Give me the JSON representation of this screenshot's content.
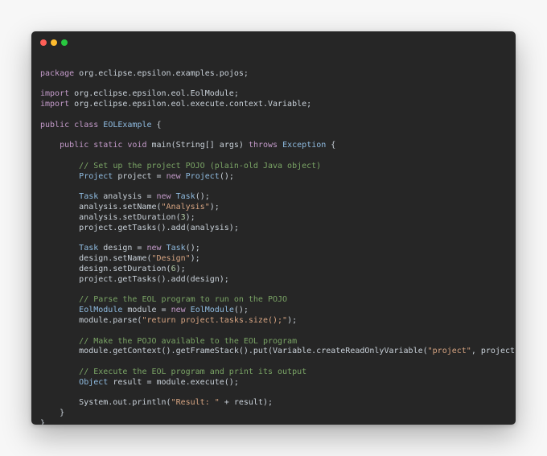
{
  "window": {
    "buttons": {
      "close_color": "#ff5f57",
      "minimize_color": "#febc2e",
      "maximize_color": "#28c840"
    }
  },
  "editor": {
    "language": "java",
    "lines": [
      [],
      [
        [
          "kw",
          "package"
        ],
        [
          "t",
          " org.eclipse.epsilon.examples.pojos;"
        ]
      ],
      [],
      [
        [
          "kw",
          "import"
        ],
        [
          "t",
          " org.eclipse.epsilon.eol.EolModule;"
        ]
      ],
      [
        [
          "kw",
          "import"
        ],
        [
          "t",
          " org.eclipse.epsilon.eol.execute.context.Variable;"
        ]
      ],
      [],
      [
        [
          "kw",
          "public"
        ],
        [
          "t",
          " "
        ],
        [
          "kw",
          "class"
        ],
        [
          "t",
          " "
        ],
        [
          "ty",
          "EOLExample"
        ],
        [
          "t",
          " {"
        ]
      ],
      [],
      [
        [
          "t",
          "    "
        ],
        [
          "kw",
          "public"
        ],
        [
          "t",
          " "
        ],
        [
          "kw",
          "static"
        ],
        [
          "t",
          " "
        ],
        [
          "kw",
          "void"
        ],
        [
          "t",
          " main(String[] args) "
        ],
        [
          "kw",
          "throws"
        ],
        [
          "t",
          " "
        ],
        [
          "ty",
          "Exception"
        ],
        [
          "t",
          " {"
        ]
      ],
      [],
      [
        [
          "t",
          "        "
        ],
        [
          "cm",
          "// Set up the project POJO (plain-old Java object)"
        ]
      ],
      [
        [
          "t",
          "        "
        ],
        [
          "ty",
          "Project"
        ],
        [
          "t",
          " project = "
        ],
        [
          "kw",
          "new"
        ],
        [
          "t",
          " "
        ],
        [
          "ty",
          "Project"
        ],
        [
          "t",
          "();"
        ]
      ],
      [],
      [
        [
          "t",
          "        "
        ],
        [
          "ty",
          "Task"
        ],
        [
          "t",
          " analysis = "
        ],
        [
          "kw",
          "new"
        ],
        [
          "t",
          " "
        ],
        [
          "ty",
          "Task"
        ],
        [
          "t",
          "();"
        ]
      ],
      [
        [
          "t",
          "        analysis.setName("
        ],
        [
          "str",
          "\"Analysis\""
        ],
        [
          "t",
          ");"
        ]
      ],
      [
        [
          "t",
          "        analysis.setDuration("
        ],
        [
          "num",
          "3"
        ],
        [
          "t",
          ");"
        ]
      ],
      [
        [
          "t",
          "        project.getTasks().add(analysis);"
        ]
      ],
      [],
      [
        [
          "t",
          "        "
        ],
        [
          "ty",
          "Task"
        ],
        [
          "t",
          " design = "
        ],
        [
          "kw",
          "new"
        ],
        [
          "t",
          " "
        ],
        [
          "ty",
          "Task"
        ],
        [
          "t",
          "();"
        ]
      ],
      [
        [
          "t",
          "        design.setName("
        ],
        [
          "str",
          "\"Design\""
        ],
        [
          "t",
          ");"
        ]
      ],
      [
        [
          "t",
          "        design.setDuration("
        ],
        [
          "num",
          "6"
        ],
        [
          "t",
          ");"
        ]
      ],
      [
        [
          "t",
          "        project.getTasks().add(design);"
        ]
      ],
      [],
      [
        [
          "t",
          "        "
        ],
        [
          "cm",
          "// Parse the EOL program to run on the POJO"
        ]
      ],
      [
        [
          "t",
          "        "
        ],
        [
          "ty",
          "EolModule"
        ],
        [
          "t",
          " module = "
        ],
        [
          "kw",
          "new"
        ],
        [
          "t",
          " "
        ],
        [
          "ty",
          "EolModule"
        ],
        [
          "t",
          "();"
        ]
      ],
      [
        [
          "t",
          "        module.parse("
        ],
        [
          "str",
          "\"return project.tasks.size();\""
        ],
        [
          "t",
          ");"
        ]
      ],
      [],
      [
        [
          "t",
          "        "
        ],
        [
          "cm",
          "// Make the POJO available to the EOL program"
        ]
      ],
      [
        [
          "t",
          "        module.getContext().getFrameStack().put(Variable.createReadOnlyVariable("
        ],
        [
          "str",
          "\"project\""
        ],
        [
          "t",
          ", project));"
        ]
      ],
      [],
      [
        [
          "t",
          "        "
        ],
        [
          "cm",
          "// Execute the EOL program and print its output"
        ]
      ],
      [
        [
          "t",
          "        "
        ],
        [
          "ty",
          "Object"
        ],
        [
          "t",
          " result = module.execute();"
        ]
      ],
      [],
      [
        [
          "t",
          "        System.out.println("
        ],
        [
          "str",
          "\"Result: \""
        ],
        [
          "t",
          " + result);"
        ]
      ],
      [
        [
          "t",
          "    }"
        ]
      ],
      [
        [
          "t",
          "}"
        ]
      ]
    ]
  }
}
